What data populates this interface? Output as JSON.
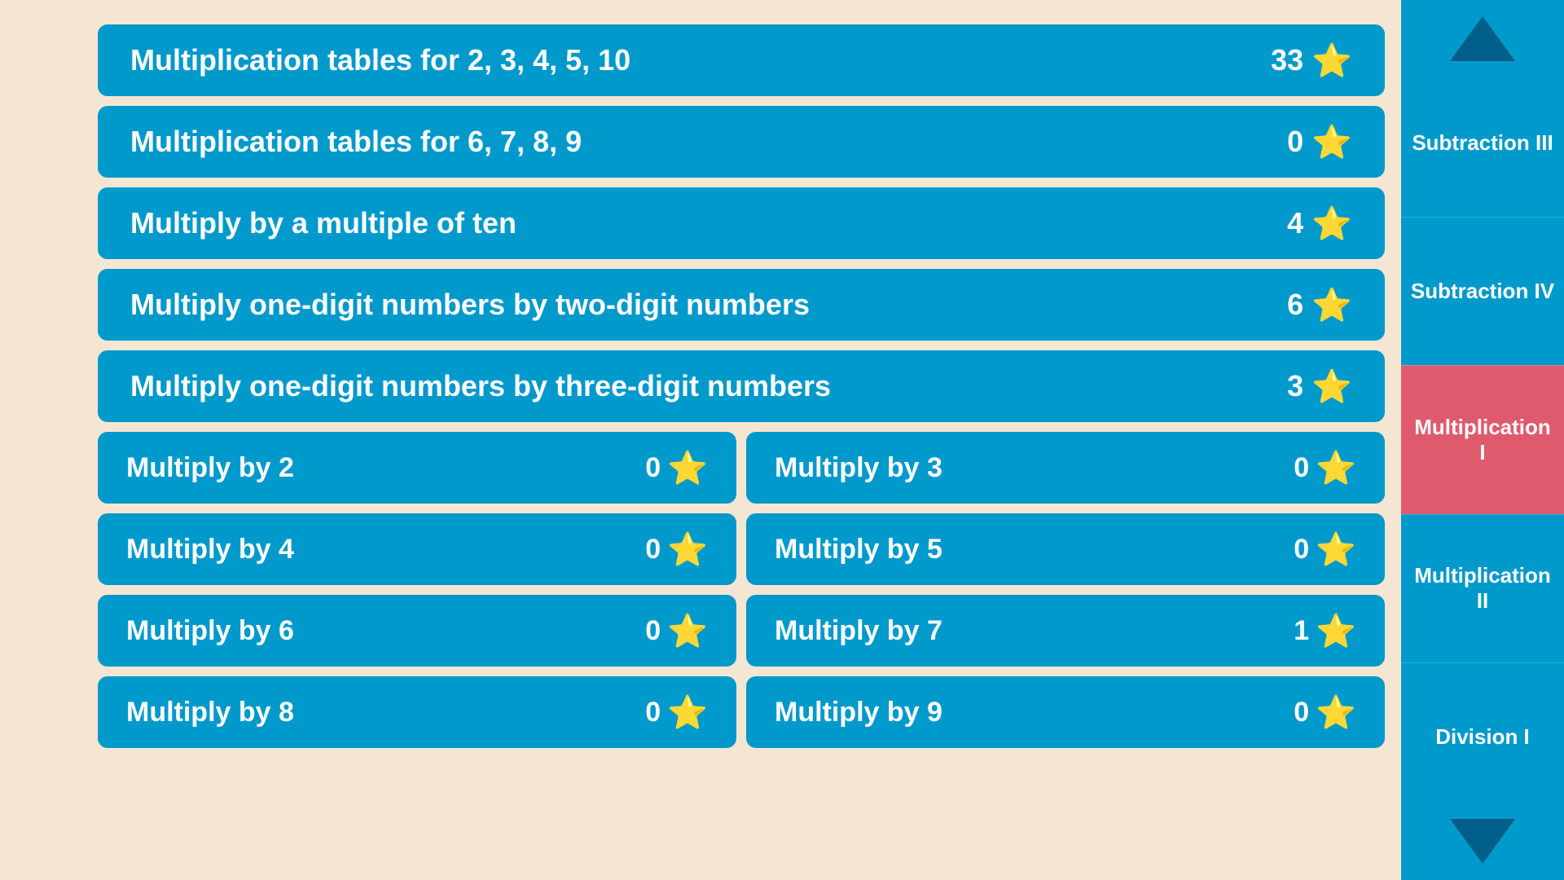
{
  "main": {
    "full_rows": [
      {
        "id": "mult-tables-2-3-4-5-10",
        "label": "Multiplication tables for 2, 3, 4, 5, 10",
        "stars": 33
      },
      {
        "id": "mult-tables-6-7-8-9",
        "label": "Multiplication tables for 6, 7, 8, 9",
        "stars": 0
      },
      {
        "id": "mult-multiple-of-ten",
        "label": "Multiply by a multiple of ten",
        "stars": 4
      },
      {
        "id": "mult-one-two-digit",
        "label": "Multiply one-digit numbers by two-digit numbers",
        "stars": 6
      },
      {
        "id": "mult-one-three-digit",
        "label": "Multiply one-digit numbers by three-digit numbers",
        "stars": 3
      }
    ],
    "half_rows": [
      [
        {
          "id": "mult-by-2",
          "label": "Multiply by 2",
          "stars": 0
        },
        {
          "id": "mult-by-3",
          "label": "Multiply by 3",
          "stars": 0
        }
      ],
      [
        {
          "id": "mult-by-4",
          "label": "Multiply by 4",
          "stars": 0
        },
        {
          "id": "mult-by-5",
          "label": "Multiply by 5",
          "stars": 0
        }
      ],
      [
        {
          "id": "mult-by-6",
          "label": "Multiply by 6",
          "stars": 0
        },
        {
          "id": "mult-by-7",
          "label": "Multiply by 7",
          "stars": 1
        }
      ],
      [
        {
          "id": "mult-by-8",
          "label": "Multiply by 8",
          "stars": 0
        },
        {
          "id": "mult-by-9",
          "label": "Multiply by 9",
          "stars": 0
        }
      ]
    ],
    "star_symbol": "★"
  },
  "sidebar": {
    "items": [
      {
        "id": "subtraction-iii",
        "label": "Subtraction III",
        "active": false
      },
      {
        "id": "subtraction-iv",
        "label": "Subtraction IV",
        "active": false
      },
      {
        "id": "multiplication-i",
        "label": "Multiplication I",
        "active": true
      },
      {
        "id": "multiplication-ii",
        "label": "Multiplication II",
        "active": false
      },
      {
        "id": "division-i",
        "label": "Division I",
        "active": false
      }
    ]
  }
}
